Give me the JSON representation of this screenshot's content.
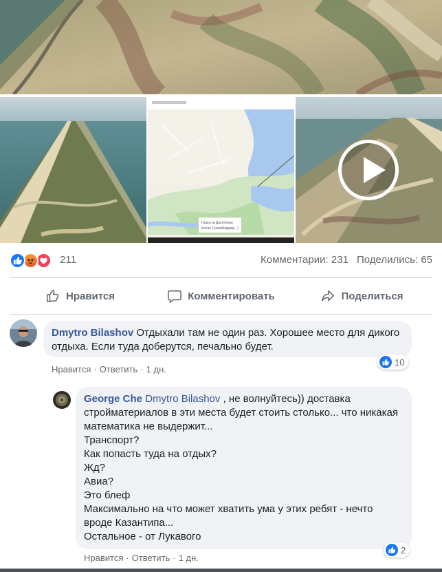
{
  "post": {
    "reactions_count": "211",
    "comments_label": "Комментарии: 231",
    "shares_label": "Поделились: 65"
  },
  "actions": {
    "like": "Нравится",
    "comment": "Комментировать",
    "share": "Поделиться"
  },
  "map": {
    "caption_line1": "Новости Дохлятина",
    "caption_line2": "Косая Тузла(Бордюр...)"
  },
  "comments": [
    {
      "author": "Dmytro Bilashov",
      "text": "Отдыхали там не один раз. Хорошее место для дикого отдыха. Если туда доберутся, печально будет.",
      "like_label": "Нравится",
      "reply_label": "Ответить",
      "time": "1 дн.",
      "likes": "10"
    }
  ],
  "reply": {
    "author": "George Che",
    "mention": "Dmytro Bilashov",
    "lines": [
      " , не волнуйтесь)) доставка стройматериалов в эти места будет стоить столько... что никакая математика не выдержит...",
      "Транспорт?",
      "Как попасть туда на отдых?",
      "Жд?",
      "Авиа?",
      "Это блеф",
      "Максимально на что может хватить ума у этих ребят - нечто вроде Казантипа...",
      "Остальное - от Лукавого"
    ],
    "like_label": "Нравится",
    "reply_label": "Ответить",
    "time": "1 дн.",
    "likes": "2"
  },
  "colors": {
    "link": "#385898",
    "like_blue": "#1877f2",
    "bubble": "#f0f2f5"
  }
}
